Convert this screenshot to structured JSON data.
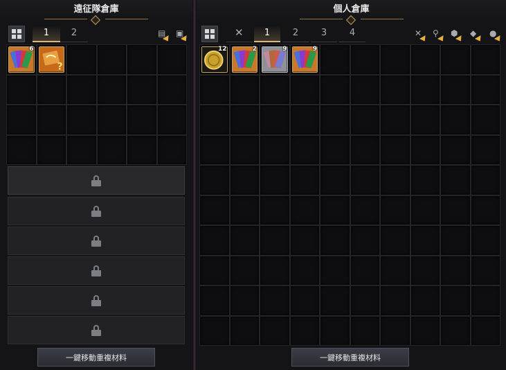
{
  "left_panel": {
    "title": "遠征隊倉庫",
    "tabs": [
      "1",
      "2"
    ],
    "active_tab": "1",
    "toolbar_icons": [
      "chest-sort-icon",
      "deposit-all-icon"
    ],
    "items": [
      {
        "name": "card-pack-icon",
        "qty": "6"
      },
      {
        "name": "card-pack-question-icon",
        "qty": ""
      }
    ],
    "locked_rows": 6,
    "bottom_button": "一鍵移動重複材料"
  },
  "right_panel": {
    "title": "個人倉庫",
    "tabs": [
      "1",
      "2",
      "3",
      "4"
    ],
    "active_tab": "1",
    "toolbar_icons": [
      "combat-deposit-icon",
      "tool-deposit-icon",
      "gem-deposit-icon",
      "card-deposit-icon",
      "misc-deposit-icon"
    ],
    "items": [
      {
        "name": "gold-coin-icon",
        "qty": "12"
      },
      {
        "name": "card-pack-icon",
        "qty": "2"
      },
      {
        "name": "card-pack-silver-icon",
        "qty": "9"
      },
      {
        "name": "card-pack-icon",
        "qty": "9"
      }
    ],
    "bottom_button": "一鍵移動重複材料"
  }
}
